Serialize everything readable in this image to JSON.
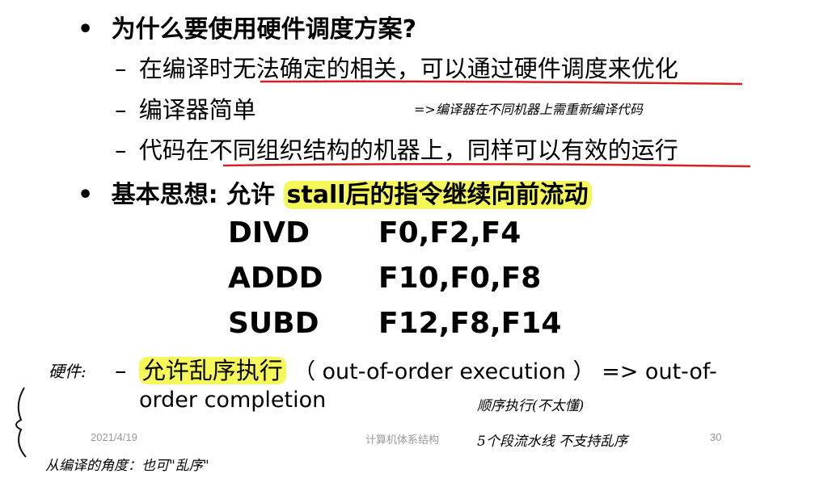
{
  "bullets": {
    "b1": "为什么要使用硬件调度方案?",
    "b1_sub1": "在编译时无法确定的相关，可以通过硬件调度来优化",
    "b1_sub2": "编译器简单",
    "b1_sub3": "代码在不同组织结构的机器上，同样可以有效的运行",
    "b2_prefix": "基本思想: 允许",
    "b2_highlight": "stall后的指令继续向前流动",
    "b2_sub1_highlight": "允许乱序执行",
    "b2_sub1_line1": "（ out-of-order execution ） => out-of-",
    "b2_sub1_line2": "order completion",
    "bullet_symbol": "•",
    "dash_symbol": "–"
  },
  "code": [
    {
      "op": "DIVD",
      "args": "F0,F2,F4"
    },
    {
      "op": "ADDD",
      "args": "F10,F0,F8"
    },
    {
      "op": "SUBD",
      "args": "F12,F8,F14"
    }
  ],
  "footer": {
    "date": "2021/4/19",
    "course": "计算机体系结构",
    "page": "30"
  },
  "annotations": {
    "near_sub2": "=>编译器在不同机器上需重新编译代码",
    "left_label": "硬件:",
    "bottom_left": "从编译的角度：也可\"乱序\"",
    "right_1": "顺序执行(不太懂)",
    "right_2": "5个段流水线 不支持乱序"
  },
  "colors": {
    "highlight": "#f6f85a",
    "underline": "#d42020",
    "ink": "#111111",
    "footer_text": "#9a9a9a"
  }
}
